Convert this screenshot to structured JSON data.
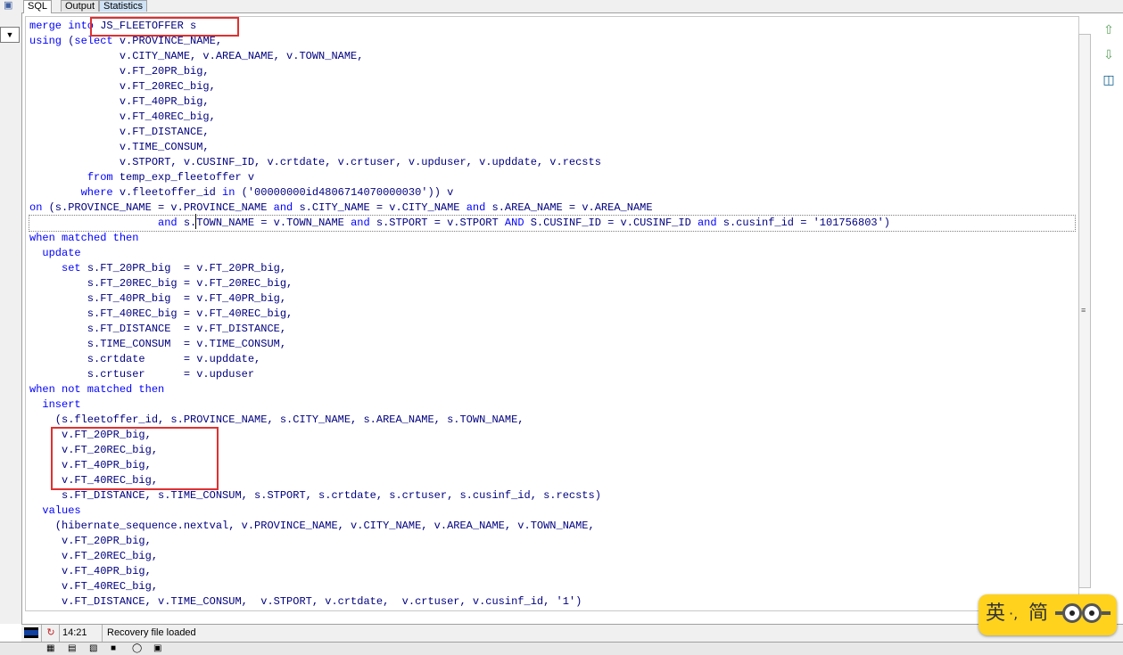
{
  "tabs": [
    {
      "label": "SQL",
      "active": true
    },
    {
      "label": "Output",
      "active": false
    },
    {
      "label": "Statistics",
      "active": false
    }
  ],
  "editor": {
    "lines": [
      [
        [
          "kw",
          "merge into "
        ],
        [
          "t",
          "JS_FLEETOFFER s"
        ]
      ],
      [
        [
          "kw",
          "using "
        ],
        [
          "t",
          "("
        ],
        [
          "kw",
          "select "
        ],
        [
          "t",
          "v.PROVINCE_NAME,"
        ]
      ],
      [
        [
          "t",
          "              v.CITY_NAME, v.AREA_NAME, v.TOWN_NAME,"
        ]
      ],
      [
        [
          "t",
          "              v.FT_20PR_big,"
        ]
      ],
      [
        [
          "t",
          "              v.FT_20REC_big,"
        ]
      ],
      [
        [
          "t",
          "              v.FT_40PR_big,"
        ]
      ],
      [
        [
          "t",
          "              v.FT_40REC_big,"
        ]
      ],
      [
        [
          "t",
          "              v.FT_DISTANCE,"
        ]
      ],
      [
        [
          "t",
          "              v.TIME_CONSUM,"
        ]
      ],
      [
        [
          "t",
          "              v.STPORT, v.CUSINF_ID, v.crtdate, v.crtuser, v.upduser, v.upddate, v.recsts"
        ]
      ],
      [
        [
          "t",
          "         "
        ],
        [
          "kw",
          "from "
        ],
        [
          "t",
          "temp_exp_fleetoffer v"
        ]
      ],
      [
        [
          "t",
          "        "
        ],
        [
          "kw",
          "where "
        ],
        [
          "t",
          "v.fleetoffer_id "
        ],
        [
          "kw",
          "in "
        ],
        [
          "t",
          "('00000000id4806714070000030')) v"
        ]
      ],
      [
        [
          "kw",
          "on "
        ],
        [
          "t",
          "(s.PROVINCE_NAME = v.PROVINCE_NAME "
        ],
        [
          "kw",
          "and "
        ],
        [
          "t",
          "s.CITY_NAME = v.CITY_NAME "
        ],
        [
          "kw",
          "and "
        ],
        [
          "t",
          "s.AREA_NAME = v.AREA_NAME"
        ]
      ],
      [
        [
          "t",
          "                    "
        ],
        [
          "kw",
          "and "
        ],
        [
          "t",
          "s.TOWN_NAME = v.TOWN_NAME "
        ],
        [
          "kw",
          "and "
        ],
        [
          "t",
          "s.STPORT = v.STPORT "
        ],
        [
          "kw",
          "AND "
        ],
        [
          "t",
          "S.CUSINF_ID = v.CUSINF_ID "
        ],
        [
          "kw",
          "and "
        ],
        [
          "t",
          "s.cusinf_id = '101756803')"
        ]
      ],
      [
        [
          "kw",
          "when matched then"
        ]
      ],
      [
        [
          "t",
          "  "
        ],
        [
          "kw",
          "update"
        ]
      ],
      [
        [
          "t",
          "     "
        ],
        [
          "kw",
          "set "
        ],
        [
          "t",
          "s.FT_20PR_big  = v.FT_20PR_big,"
        ]
      ],
      [
        [
          "t",
          "         s.FT_20REC_big = v.FT_20REC_big,"
        ]
      ],
      [
        [
          "t",
          "         s.FT_40PR_big  = v.FT_40PR_big,"
        ]
      ],
      [
        [
          "t",
          "         s.FT_40REC_big = v.FT_40REC_big,"
        ]
      ],
      [
        [
          "t",
          "         s.FT_DISTANCE  = v.FT_DISTANCE,"
        ]
      ],
      [
        [
          "t",
          "         s.TIME_CONSUM  = v.TIME_CONSUM,"
        ]
      ],
      [
        [
          "t",
          "         s.crtdate      = v.upddate,"
        ]
      ],
      [
        [
          "t",
          "         s.crtuser      = v.upduser"
        ]
      ],
      [
        [
          "kw",
          "when not matched then"
        ]
      ],
      [
        [
          "t",
          "  "
        ],
        [
          "kw",
          "insert"
        ]
      ],
      [
        [
          "t",
          "    (s.fleetoffer_id, s.PROVINCE_NAME, s.CITY_NAME, s.AREA_NAME, s.TOWN_NAME,"
        ]
      ],
      [
        [
          "t",
          "     v.FT_20PR_big,"
        ]
      ],
      [
        [
          "t",
          "     v.FT_20REC_big,"
        ]
      ],
      [
        [
          "t",
          "     v.FT_40PR_big,"
        ]
      ],
      [
        [
          "t",
          "     v.FT_40REC_big,"
        ]
      ],
      [
        [
          "t",
          "     s.FT_DISTANCE, s.TIME_CONSUM, s.STPORT, s.crtdate, s.crtuser, s.cusinf_id, s.recsts)"
        ]
      ],
      [
        [
          "t",
          "  "
        ],
        [
          "kw",
          "values"
        ]
      ],
      [
        [
          "t",
          "    (hibernate_sequence.nextval, v.PROVINCE_NAME, v.CITY_NAME, v.AREA_NAME, v.TOWN_NAME,"
        ]
      ],
      [
        [
          "t",
          "     v.FT_20PR_big,"
        ]
      ],
      [
        [
          "t",
          "     v.FT_20REC_big,"
        ]
      ],
      [
        [
          "t",
          "     v.FT_40PR_big,"
        ]
      ],
      [
        [
          "t",
          "     v.FT_40REC_big,"
        ]
      ],
      [
        [
          "t",
          "     v.FT_DISTANCE, v.TIME_CONSUM,  v.STPORT, v.crtdate,  v.crtuser, v.cusinf_id, '1')"
        ]
      ]
    ],
    "current_line": 13
  },
  "status": {
    "time": "14:21",
    "message": "Recovery file loaded"
  },
  "ime": {
    "char1": "英",
    "char2": "·,",
    "char3": "简"
  },
  "colors": {
    "keyword": "#0000ff",
    "text": "#000080",
    "highlight_box": "#e03030",
    "ime_bg": "#ffd21e"
  }
}
